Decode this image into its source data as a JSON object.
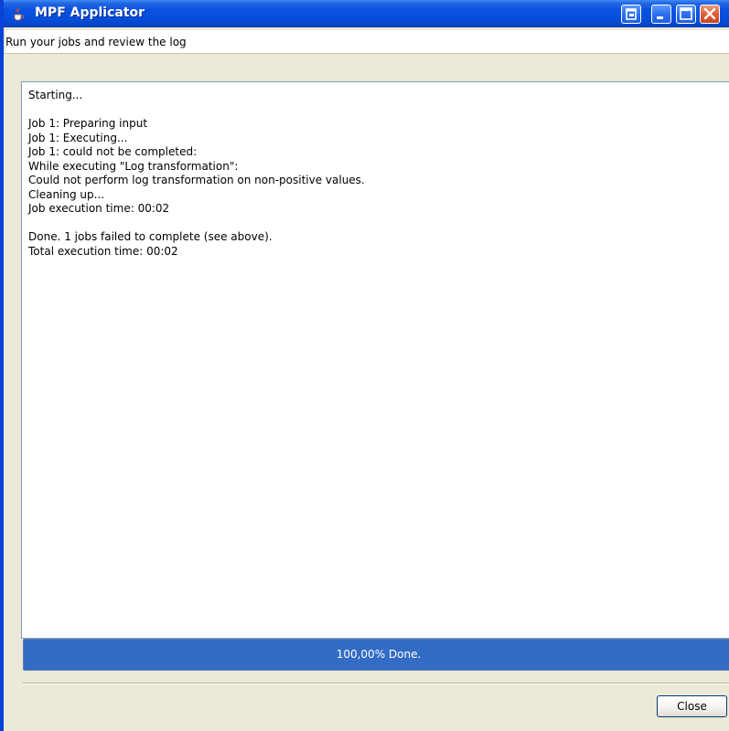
{
  "window": {
    "title": "MPF Applicator",
    "subtitle": "Run your jobs and review the log",
    "controls": [
      "maximize-alt-icon",
      "minimize-icon",
      "maximize-icon",
      "close-icon"
    ]
  },
  "log": {
    "lines": [
      "Starting...",
      "",
      "Job 1: Preparing input",
      "Job 1: Executing...",
      "Job 1: could not be completed:",
      "While executing \"Log transformation\":",
      "Could not perform log transformation on non-positive values.",
      "Cleaning up...",
      "Job execution time: 00:02",
      "",
      "Done. 1 jobs failed to complete (see above).",
      "Total execution time: 00:02"
    ]
  },
  "progress": {
    "value": 1.0,
    "label": "100,00% Done.",
    "color": "#336cc4"
  },
  "footer": {
    "close_label": "Close"
  },
  "colors": {
    "titlebar": "#0550dc",
    "window_bg": "#ece9d8",
    "log_border": "#7f9db9"
  }
}
